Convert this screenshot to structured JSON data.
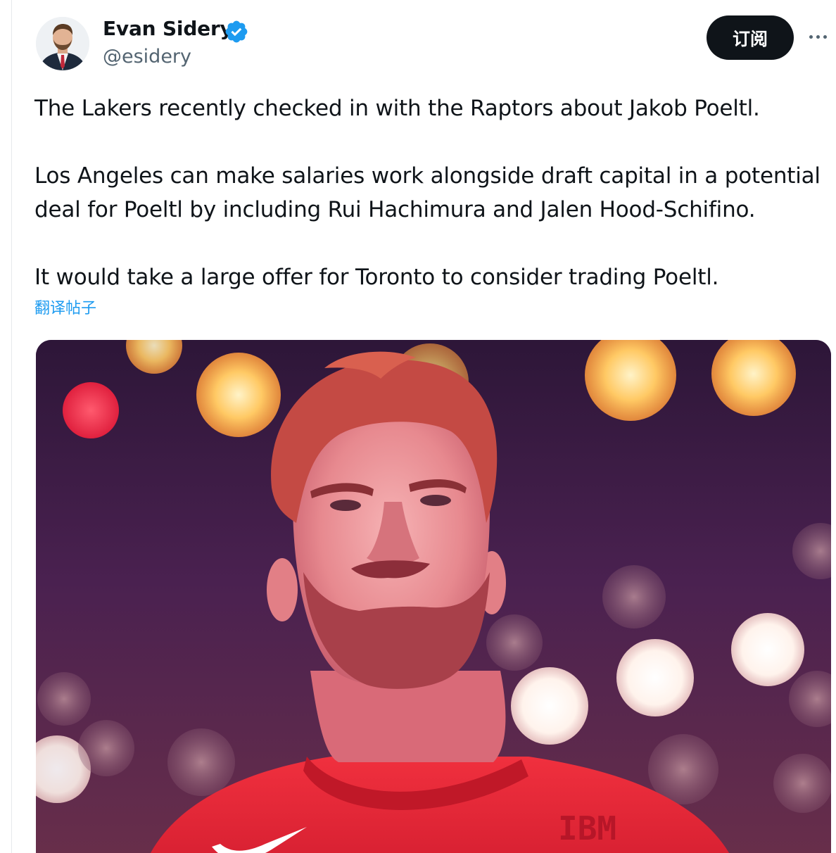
{
  "author": {
    "display_name": "Evan Sidery",
    "handle": "@esidery",
    "verified": true
  },
  "actions": {
    "subscribe_label": "订阅",
    "more_icon": "ellipsis-icon"
  },
  "tweet": {
    "paragraphs": [
      "The Lakers recently checked in with the Raptors about Jakob Poeltl.",
      "Los Angeles can make salaries work alongside draft capital in a potential deal for Poeltl by including Rui Hachimura and Jalen Hood-Schifino.",
      "It would take a large offer for Toronto to consider trading Poeltl."
    ],
    "translate_label": "翻译帖子"
  },
  "media": {
    "jersey_text": "IBM"
  },
  "colors": {
    "text_primary": "#0f1419",
    "text_secondary": "#536471",
    "link": "#1d9bf0",
    "button_bg": "#0f1419",
    "verified_badge": "#1d9bf0"
  }
}
